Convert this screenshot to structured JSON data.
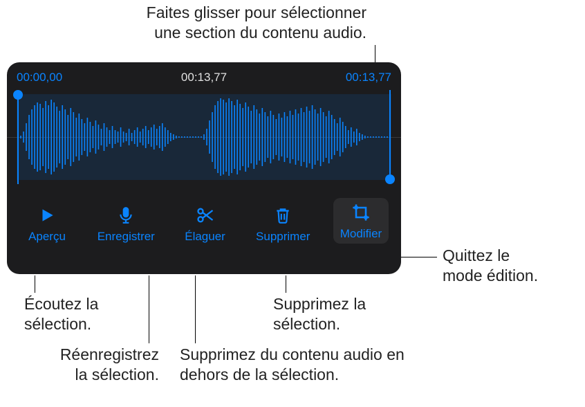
{
  "callouts": {
    "drag_select": "Faites glisser pour sélectionner\nune section du contenu audio.",
    "exit_edit": "Quittez le\nmode édition.",
    "listen": "Écoutez la\nsélection.",
    "rerecord": "Réenregistrez\nla sélection.",
    "delete_outside": "Supprimez du contenu audio en\ndehors de la sélection.",
    "delete_sel": "Supprimez la\nsélection."
  },
  "editor": {
    "time_start": "00:00,00",
    "time_mid": "00:13,77",
    "time_end": "00:13,77",
    "toolbar": {
      "preview": "Aperçu",
      "record": "Enregistrer",
      "trim": "Élaguer",
      "delete": "Supprimer",
      "modify": "Modifier"
    }
  },
  "colors": {
    "accent": "#0a84ff",
    "panel_bg": "#1c1c1e"
  }
}
